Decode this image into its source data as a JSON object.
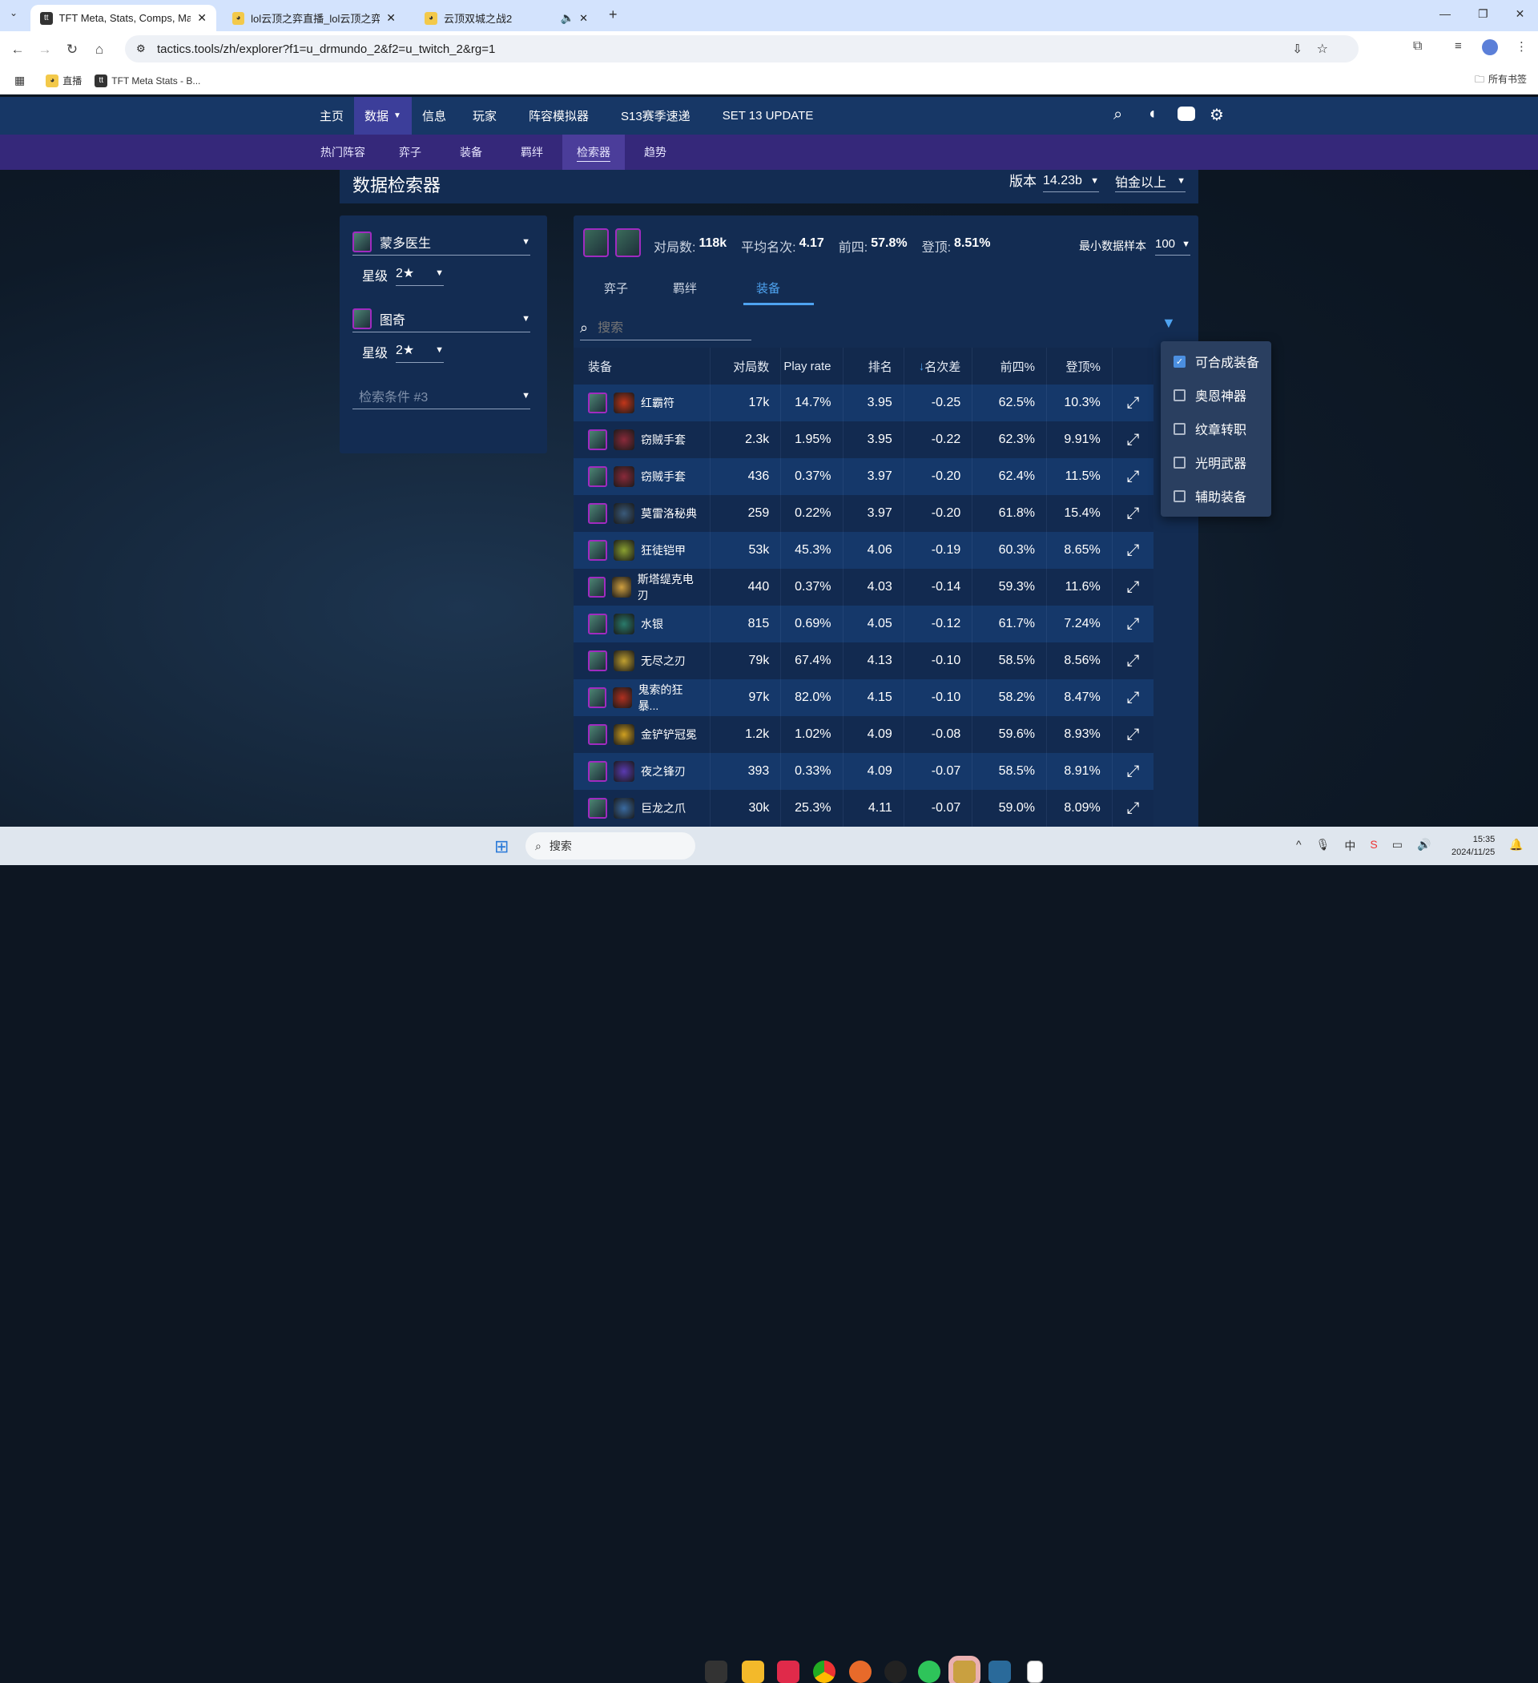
{
  "browser": {
    "tabs": [
      {
        "title": "TFT Meta, Stats, Comps, Mat",
        "favicon": "tt",
        "active": true
      },
      {
        "title": "lol云顶之弈直播_lol云顶之弈直",
        "favicon": "huya"
      },
      {
        "title": "云顶双城之战2",
        "favicon": "huya",
        "audio": true
      }
    ],
    "url": "tactics.tools/zh/explorer?f1=u_drmundo_2&f2=u_twitch_2&rg=1",
    "bookmarks": [
      {
        "label": "直播"
      },
      {
        "label": "TFT Meta Stats - B..."
      }
    ],
    "all_bookmarks": "所有书签"
  },
  "nav": {
    "items": [
      "主页",
      "数据",
      "信息",
      "玩家",
      "阵容模拟器",
      "S13赛季速递",
      "SET 13 UPDATE"
    ],
    "active": "数据"
  },
  "subnav": {
    "items": [
      "热门阵容",
      "弈子",
      "装备",
      "羁绊",
      "检索器",
      "趋势"
    ],
    "active": "检索器"
  },
  "page": {
    "title": "数据检索器",
    "version_label": "版本",
    "version": "14.23b",
    "rank": "铂金以上"
  },
  "filters": [
    {
      "unit": "蒙多医生",
      "star_label": "星级",
      "star": "2★"
    },
    {
      "unit": "图奇",
      "star_label": "星级",
      "star": "2★"
    },
    {
      "placeholder": "检索条件 #3"
    }
  ],
  "summary": {
    "games_label": "对局数:",
    "games": "118k",
    "avg_label": "平均名次:",
    "avg": "4.17",
    "top4_label": "前四:",
    "top4": "57.8%",
    "win_label": "登顶:",
    "win": "8.51%",
    "min_sample_label": "最小数据样本",
    "min_sample": "100"
  },
  "tabs": [
    {
      "label": "弈子"
    },
    {
      "label": "羁绊"
    },
    {
      "label": "装备",
      "active": true
    }
  ],
  "search": {
    "placeholder": "搜索"
  },
  "table": {
    "headers": [
      "装备",
      "对局数",
      "Play rate",
      "排名",
      "名次差",
      "前四%",
      "登顶%"
    ],
    "sort": "名次差",
    "rows": [
      {
        "item": "红霸符",
        "games": "17k",
        "rate": "14.7%",
        "place": "3.95",
        "delta": "-0.25",
        "top4": "62.5%",
        "win": "10.3%",
        "color": "#c2361a"
      },
      {
        "item": "窃贼手套",
        "games": "2.3k",
        "rate": "1.95%",
        "place": "3.95",
        "delta": "-0.22",
        "top4": "62.3%",
        "win": "9.91%",
        "color": "#8a2a3a"
      },
      {
        "item": "窃贼手套",
        "games": "436",
        "rate": "0.37%",
        "place": "3.97",
        "delta": "-0.20",
        "top4": "62.4%",
        "win": "11.5%",
        "color": "#8a2a3a"
      },
      {
        "item": "莫雷洛秘典",
        "games": "259",
        "rate": "0.22%",
        "place": "3.97",
        "delta": "-0.20",
        "top4": "61.8%",
        "win": "15.4%",
        "color": "#3a5a7a"
      },
      {
        "item": "狂徒铠甲",
        "games": "53k",
        "rate": "45.3%",
        "place": "4.06",
        "delta": "-0.19",
        "top4": "60.3%",
        "win": "8.65%",
        "color": "#8aa030"
      },
      {
        "item": "斯塔缇克电刃",
        "games": "440",
        "rate": "0.37%",
        "place": "4.03",
        "delta": "-0.14",
        "top4": "59.3%",
        "win": "11.6%",
        "color": "#d0a040"
      },
      {
        "item": "水银",
        "games": "815",
        "rate": "0.69%",
        "place": "4.05",
        "delta": "-0.12",
        "top4": "61.7%",
        "win": "7.24%",
        "color": "#2a7a6a"
      },
      {
        "item": "无尽之刃",
        "games": "79k",
        "rate": "67.4%",
        "place": "4.13",
        "delta": "-0.10",
        "top4": "58.5%",
        "win": "8.56%",
        "color": "#c0a030"
      },
      {
        "item": "鬼索的狂暴...",
        "games": "97k",
        "rate": "82.0%",
        "place": "4.15",
        "delta": "-0.10",
        "top4": "58.2%",
        "win": "8.47%",
        "color": "#b03020"
      },
      {
        "item": "金铲铲冠冕",
        "games": "1.2k",
        "rate": "1.02%",
        "place": "4.09",
        "delta": "-0.08",
        "top4": "59.6%",
        "win": "8.93%",
        "color": "#d0a020"
      },
      {
        "item": "夜之锋刃",
        "games": "393",
        "rate": "0.33%",
        "place": "4.09",
        "delta": "-0.07",
        "top4": "58.5%",
        "win": "8.91%",
        "color": "#5a3ab0"
      },
      {
        "item": "巨龙之爪",
        "games": "30k",
        "rate": "25.3%",
        "place": "4.11",
        "delta": "-0.07",
        "top4": "59.0%",
        "win": "8.09%",
        "color": "#3a6aa0"
      }
    ]
  },
  "filter_menu": [
    {
      "label": "可合成装备",
      "checked": true
    },
    {
      "label": "奥恩神器",
      "checked": false
    },
    {
      "label": "纹章转职",
      "checked": false
    },
    {
      "label": "光明武器",
      "checked": false
    },
    {
      "label": "辅助装备",
      "checked": false
    }
  ],
  "taskbar": {
    "search": "搜索",
    "time": "15:35",
    "date": "2024/11/25"
  },
  "colors": {
    "nav": "#173766",
    "subnav": "#35287a",
    "panel": "#132c52",
    "accent": "#4ea3f0"
  }
}
